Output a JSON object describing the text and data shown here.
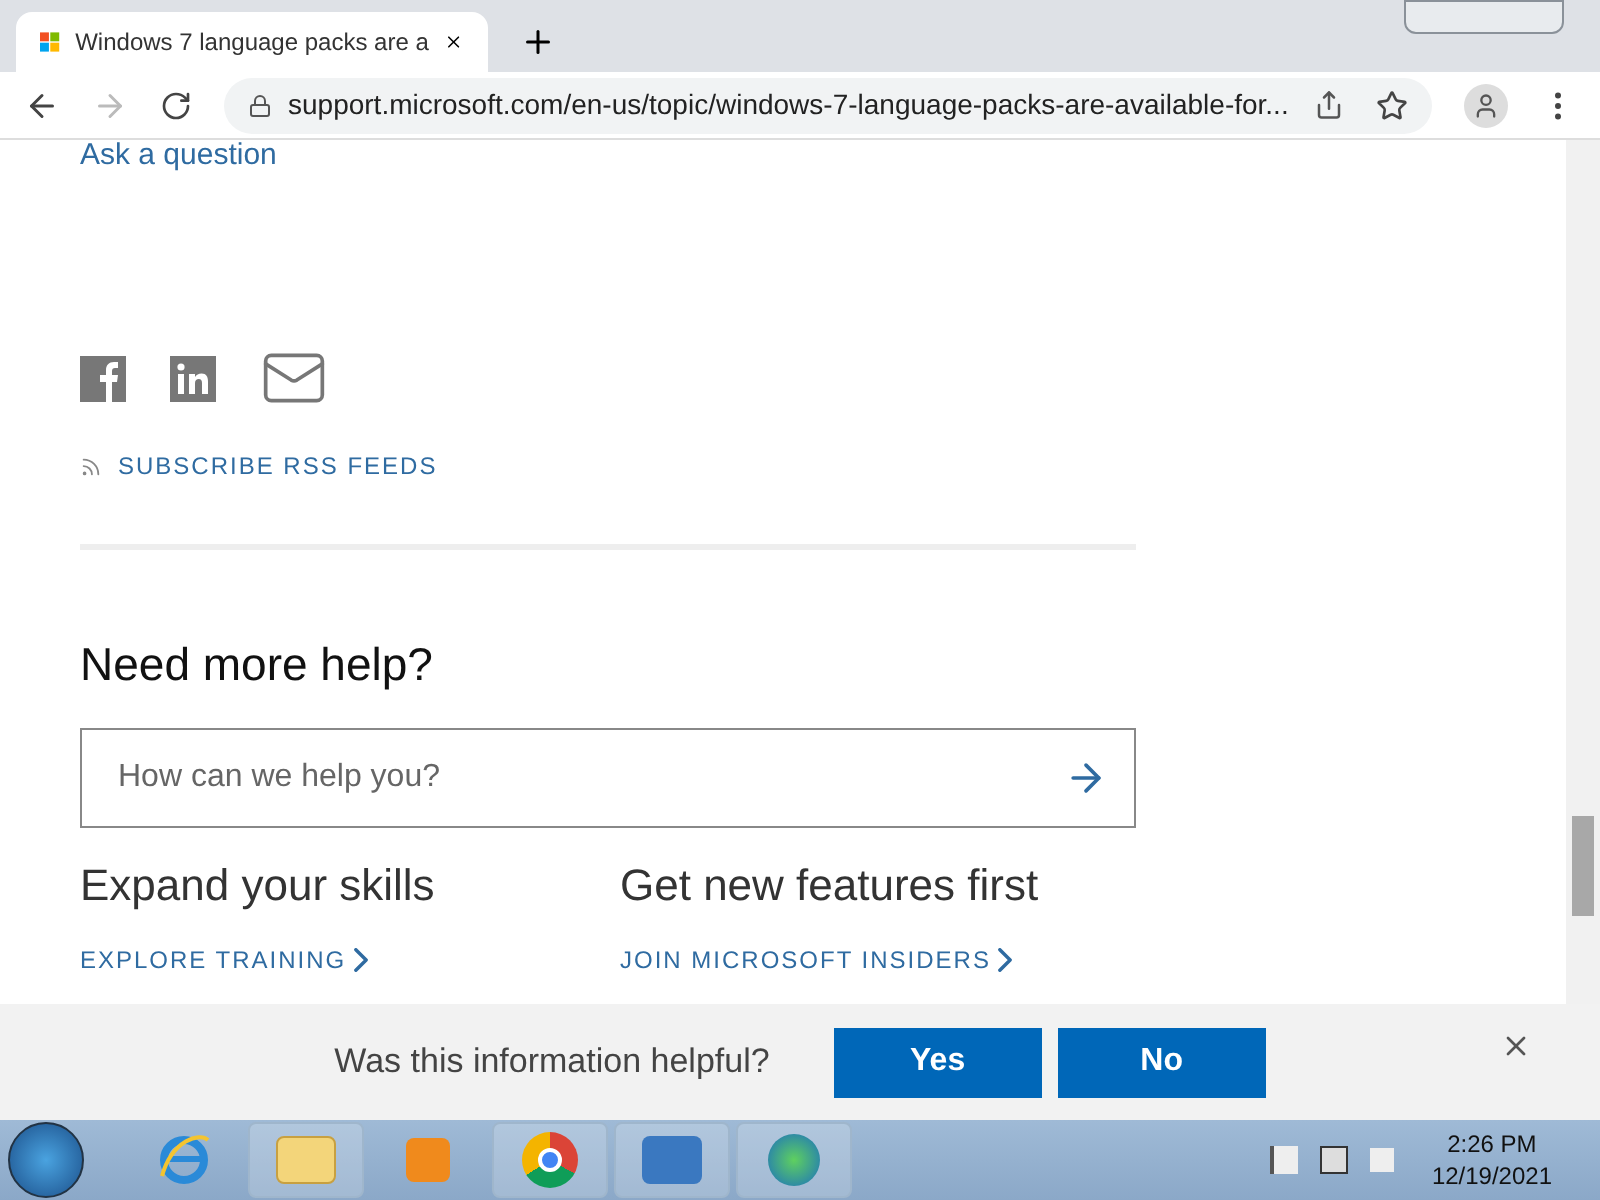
{
  "browser": {
    "tab_title": "Windows 7 language packs are a",
    "url": "support.microsoft.com/en-us/topic/windows-7-language-packs-are-available-for..."
  },
  "page": {
    "ask_link": "Ask a question",
    "rss_link": "SUBSCRIBE RSS FEEDS",
    "help_heading": "Need more help?",
    "search": {
      "placeholder": "How can we help you?"
    },
    "promos": [
      {
        "heading": "Expand your skills",
        "link": "EXPLORE TRAINING"
      },
      {
        "heading": "Get new features first",
        "link": "JOIN MICROSOFT INSIDERS"
      }
    ]
  },
  "feedback": {
    "question": "Was this information helpful?",
    "buttons": [
      "Yes",
      "No"
    ]
  },
  "taskbar": {
    "time": "2:26 PM",
    "date": "12/19/2021"
  }
}
